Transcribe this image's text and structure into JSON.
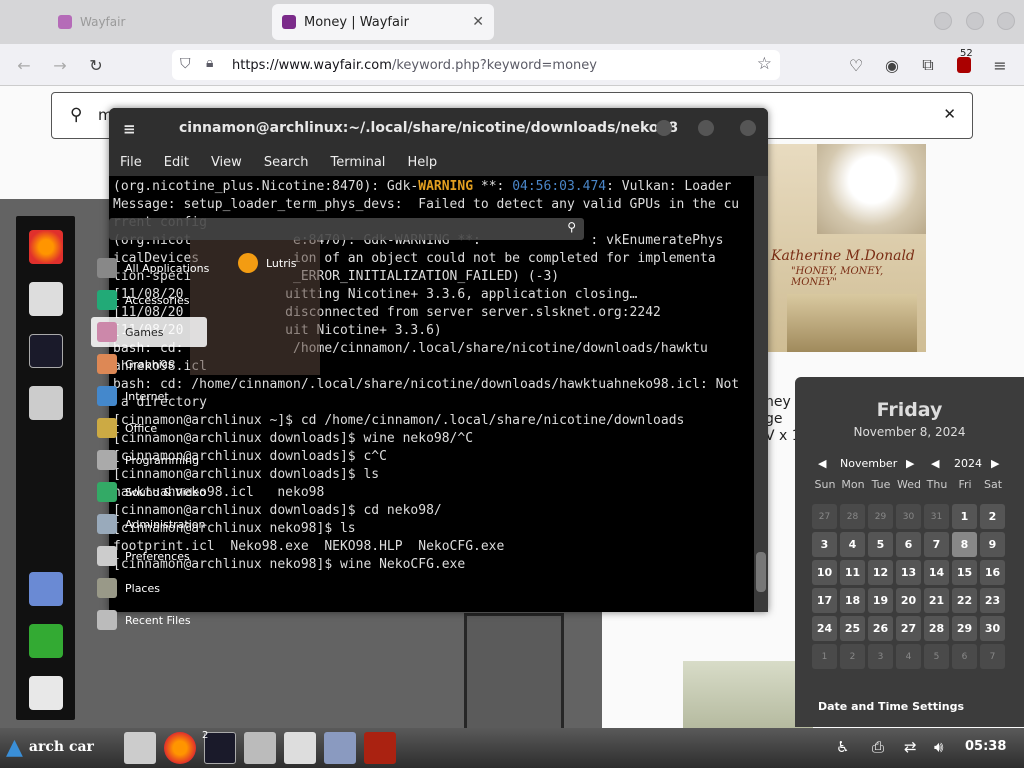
{
  "browser": {
    "tabs": [
      {
        "label": "Wayfair"
      },
      {
        "label": "Money | Wayfair"
      }
    ],
    "url_domain": "https://www.wayfair.com",
    "url_path": "/keyword.php?keyword=money",
    "notification_count": "52"
  },
  "page": {
    "search_value": "m",
    "poster_title": "Katherine M.Donald",
    "poster_sub": "\"HONEY, MONEY, MONEY\"",
    "product_text": [
      "ney Money \"",
      "ge",
      "V x 1.5\" D"
    ]
  },
  "terminal": {
    "title": "cinnamon@archlinux:~/.local/share/nicotine/downloads/neko98",
    "menu": [
      "File",
      "Edit",
      "View",
      "Search",
      "Terminal",
      "Help"
    ],
    "lines": [
      {
        "pre": "(org.nicotine_plus.Nicotine:8470): Gdk-",
        "warn": "WARNING",
        "mid": " **: ",
        "ts": "04:56:03.474",
        "post": ": Vulkan: Loader"
      },
      {
        "text": "Message: setup_loader_term_phys_devs:  Failed to detect any valid GPUs in the cu"
      },
      {
        "text": "rrent config"
      },
      {
        "text": "(org.nicot             e:8470): Gdk-WARNING **:              : vkEnumeratePhys"
      },
      {
        "text": "icalDevices            ion of an object could not be completed for implementa"
      },
      {
        "text": "tion-speci             _ERROR_INITIALIZATION_FAILED) (-3)"
      },
      {
        "text": "[11/08/20             uitting Nicotine+ 3.3.6, application closing…"
      },
      {
        "text": "[11/08/20             disconnected from server server.slsknet.org:2242"
      },
      {
        "text": "[11/08/20             uit Nicotine+ 3.3.6)"
      },
      {
        "text": "bash: cd:              /home/cinnamon/.local/share/nicotine/downloads/hawktu"
      },
      {
        "text": "ahneko98.icl"
      },
      {
        "text": "bash: cd: /home/cinnamon/.local/share/nicotine/downloads/hawktuahneko98.icl: Not"
      },
      {
        "text": " a directory"
      },
      {
        "text": "[cinnamon@archlinux ~]$ cd /home/cinnamon/.local/share/nicotine/downloads"
      },
      {
        "text": "[cinnamon@archlinux downloads]$ wine neko98/^C"
      },
      {
        "text": "[cinnamon@archlinux downloads]$ c^C"
      },
      {
        "text": "[cinnamon@archlinux downloads]$ ls"
      },
      {
        "text": "hawktuahneko98.icl   neko98"
      },
      {
        "text": "[cinnamon@archlinux downloads]$ cd neko98/"
      },
      {
        "text": "[cinnamon@archlinux neko98]$ ls"
      },
      {
        "text": "footprint.icl  Neko98.exe  NEKO98.HLP  NekoCFG.exe"
      },
      {
        "text": "[cinnamon@archlinux neko98]$ wine NekoCFG.exe"
      }
    ]
  },
  "menu": {
    "categories": [
      "All Applications",
      "Accessories",
      "Games",
      "Graphics",
      "Internet",
      "Office",
      "Programming",
      "Sound & Video",
      "Administration",
      "Preferences",
      "Places",
      "Recent Files"
    ],
    "app_lutris": "Lutris"
  },
  "calendar": {
    "day": "Friday",
    "date": "November 8, 2024",
    "month": "November",
    "year": "2024",
    "weekdays": [
      "Sun",
      "Mon",
      "Tue",
      "Wed",
      "Thu",
      "Fri",
      "Sat"
    ],
    "settings": "Date and Time Settings"
  },
  "taskbar": {
    "start_label": "arch car",
    "term_badge": "2",
    "clock": "05:38"
  }
}
